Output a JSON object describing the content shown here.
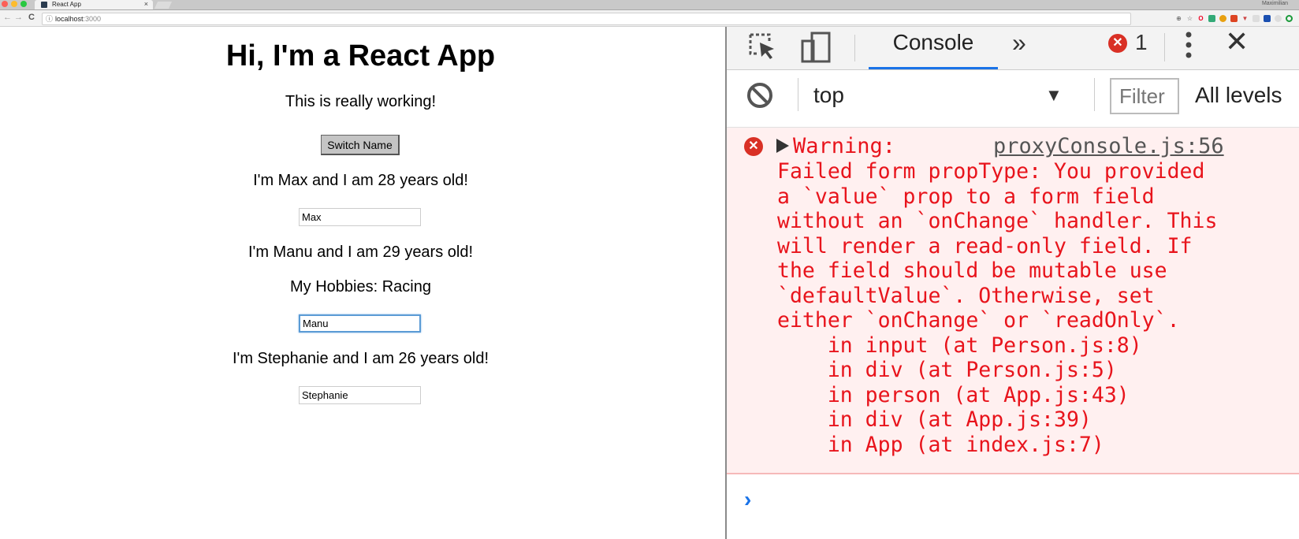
{
  "browser": {
    "tab_title": "React App",
    "tab_close": "×",
    "profile_name": "Maximilian",
    "url_host": "localhost",
    "url_port": ":3000",
    "nav": {
      "back": "←",
      "forward": "→",
      "reload": "C"
    }
  },
  "app": {
    "heading": "Hi, I'm a React App",
    "subtitle": "This is really working!",
    "switch_button": "Switch Name",
    "persons": [
      {
        "text": "I'm Max and I am 28 years old!",
        "input_value": "Max"
      },
      {
        "text": "I'm Manu and I am 29 years old!",
        "hobbies": "My Hobbies: Racing",
        "input_value": "Manu"
      },
      {
        "text": "I'm Stephanie and I am 26 years old!",
        "input_value": "Stephanie"
      }
    ]
  },
  "devtools": {
    "tabs": {
      "console": "Console",
      "more": "»"
    },
    "error_count": "1",
    "close": "✕",
    "context": "top",
    "filter_placeholder": "Filter",
    "levels": "All levels",
    "message": {
      "label": "Warning:",
      "source": "proxyConsole.js:56",
      "body": "Failed form propType: You provided\na `value` prop to a form field\nwithout an `onChange` handler. This\nwill render a read-only field. If\nthe field should be mutable use\n`defaultValue`. Otherwise, set\neither `onChange` or `readOnly`.\n    in input (at Person.js:8)\n    in div (at Person.js:5)\n    in person (at App.js:43)\n    in div (at App.js:39)\n    in App (at index.js:7)"
    },
    "prompt": "›"
  },
  "colors": {
    "error_red": "#e8141c",
    "error_bg": "#fff0f0",
    "accent_blue": "#1a73e8"
  }
}
